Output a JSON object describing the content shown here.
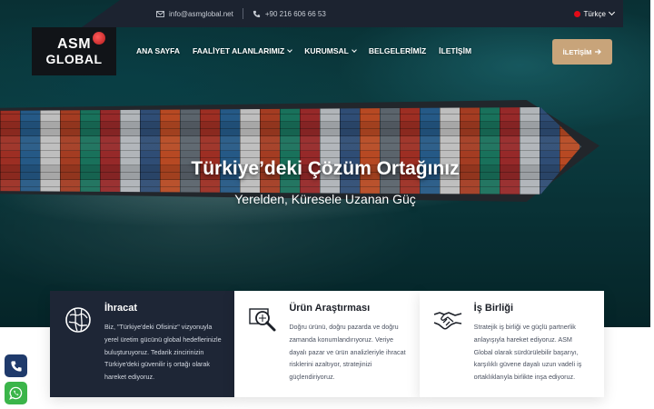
{
  "topbar": {
    "email": "info@asmglobal.net",
    "phone": "+90 216 606 66 53",
    "language": "Türkçe",
    "email_icon": "mail-icon",
    "phone_icon": "phone-icon"
  },
  "logo": {
    "line1": "ASM",
    "line2": "GLOBAL"
  },
  "nav": {
    "items": [
      {
        "label": "ANA SAYFA"
      },
      {
        "label": "FAALİYET ALANLARIMIZ"
      },
      {
        "label": "KURUMSAL"
      },
      {
        "label": "BELGELERİMİZ"
      },
      {
        "label": "İLETİŞİM"
      }
    ],
    "cta_label": "İLETİŞİM"
  },
  "hero": {
    "title": "Türkiye’deki Çözüm Ortağınız",
    "subtitle": "Yerelden, Küresele Uzanan Güç"
  },
  "cards": [
    {
      "title": "İhracat",
      "text": "Biz, \"Türkiye'deki Ofisiniz\" vizyonuyla yerel üretim gücünü global hedeflerinizle buluşturuyoruz. Tedarik zincirinizin Türkiye'deki güvenilir iş ortağı olarak hareket ediyoruz.",
      "icon": "globe-icon"
    },
    {
      "title": "Ürün Araştırması",
      "text": "Doğru ürünü, doğru pazarda ve doğru zamanda konumlandırıyoruz. Veriye dayalı pazar ve ürün analizleriyle ihracat risklerini azaltıyor, stratejinizi güçlendiriyoruz.",
      "icon": "magnifier-icon"
    },
    {
      "title": "İş Birliği",
      "text": "Stratejik iş birliği ve güçlü partnerlik anlayışıyla hareket ediyoruz. ASM Global olarak sürdürülebilir başarıyı, karşılıklı güvene dayalı uzun vadeli iş ortaklıklarıyla birlikte inşa ediyoruz.",
      "icon": "handshake-icon"
    }
  ],
  "colors": {
    "dark_navy": "#1e2636",
    "accent_gold": "#c8a47a",
    "whatsapp_green": "#3bb54a"
  }
}
